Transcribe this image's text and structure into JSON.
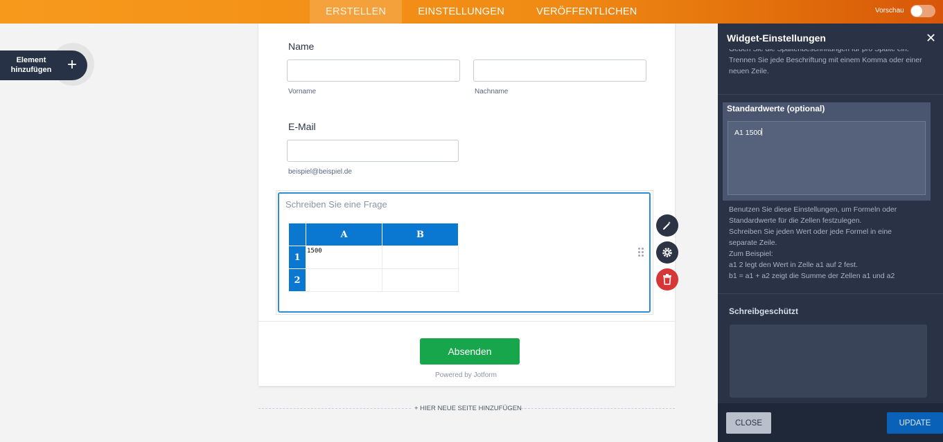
{
  "topbar": {
    "tabs": [
      {
        "label": "ERSTELLEN",
        "active": true
      },
      {
        "label": "EINSTELLUNGEN",
        "active": false
      },
      {
        "label": "VERÖFFENTLICHEN",
        "active": false
      }
    ],
    "preview_label": "Vorschau",
    "preview_on": false
  },
  "sidebar": {
    "add_element_label": "Element hinzufügen",
    "add_icon": "plus-icon"
  },
  "form": {
    "name_label": "Name",
    "first_name_sublabel": "Vorname",
    "last_name_sublabel": "Nachname",
    "email_label": "E-Mail",
    "email_sublabel": "beispiel@beispiel.de",
    "question_placeholder": "Schreiben Sie eine Frage",
    "spreadsheet": {
      "columns": [
        "A",
        "B"
      ],
      "rows": [
        {
          "label": "1",
          "cells": [
            "1500",
            ""
          ]
        },
        {
          "label": "2",
          "cells": [
            "",
            ""
          ]
        }
      ]
    },
    "submit_label": "Absenden",
    "powered_by": "Powered by Jotform",
    "new_page_label": "+ HIER NEUE SEITE HINZUFÜGEN",
    "tool_icons": [
      "magic-wand-icon",
      "gear-icon",
      "trash-icon"
    ]
  },
  "panel": {
    "title": "Widget-Einstellungen",
    "top_text": "Geben Sie die Spaltenbeschriftungen für pro Spalte ein. Trennen Sie jede Beschriftung mit einem Komma oder einer neuen Zeile.",
    "default_values_label": "Standardwerte (optional)",
    "default_values_value": "A1 1500",
    "help_lines": [
      "Benutzen Sie diese Einstellungen, um Formeln oder",
      "Standardwerte für die Zellen festzulegen.",
      "Schreiben Sie jeden Wert oder jede Formel in eine",
      "separate Zeile.",
      "Zum Beispiel:",
      "a1 2 legt den Wert in Zelle a1 auf 2 fest.",
      "b1 = a1 + a2 zeigt die Summe der Zellen a1 und a2"
    ],
    "readonly_label": "Schreibgeschützt",
    "close_button": "CLOSE",
    "update_button": "UPDATE"
  },
  "colors": {
    "accent_orange": "#f08a14",
    "panel_bg": "#293345",
    "sheet_header": "#0a78d0",
    "submit_green": "#18a64c",
    "update_blue": "#0a62b8"
  }
}
